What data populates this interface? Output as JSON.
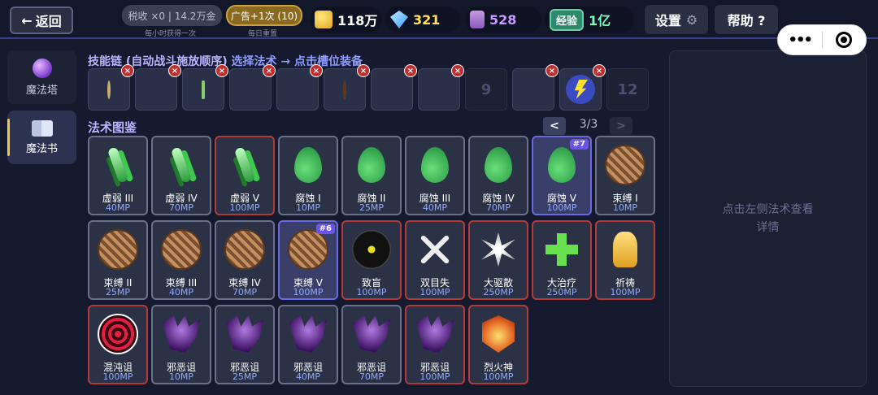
{
  "topbar": {
    "back_label": "返回",
    "tax": "税收 ×0 | 14.2万金",
    "tax_sub": "每小时获得一次",
    "ad": "广告+1次 (10)",
    "ad_sub": "每日重置",
    "gold": "118万",
    "gems": "321",
    "potions": "528",
    "exp_label": "经验",
    "exp_value": "1亿",
    "settings_label": "设置",
    "help_label": "帮助 ?"
  },
  "sidebar": {
    "items": [
      {
        "label": "魔法塔",
        "icon": "orb-icon"
      },
      {
        "label": "魔法书",
        "icon": "book-icon",
        "active": true
      }
    ]
  },
  "chain": {
    "title": "技能链 (自动战斗施放顺序)",
    "hint": "选择法术 → 点击槽位装备",
    "slots": [
      {
        "icon": "star-medal-icon"
      },
      {
        "icon": "trophy-icon"
      },
      {
        "icon": "clover-icon"
      },
      {
        "icon": "wing-icon"
      },
      {
        "icon": "lightning-dash-icon"
      },
      {
        "icon": "bind-ball-icon"
      },
      {
        "icon": "poison-drop-icon"
      },
      {
        "icon": "golden-eye-icon"
      },
      {
        "label": "9"
      },
      {
        "icon": "duel-icon"
      },
      {
        "icon": "lightning-orb-icon"
      },
      {
        "label": "12"
      }
    ]
  },
  "grimoire": {
    "title": "法术图鉴",
    "page": "3/3",
    "prev": "<",
    "next": ">",
    "spells": [
      {
        "name": "虚弱 III",
        "mp": "40MP",
        "art": "claw"
      },
      {
        "name": "虚弱 IV",
        "mp": "70MP",
        "art": "claw"
      },
      {
        "name": "虚弱 V",
        "mp": "100MP",
        "art": "claw",
        "red": true
      },
      {
        "name": "腐蚀 I",
        "mp": "10MP",
        "art": "drop"
      },
      {
        "name": "腐蚀 II",
        "mp": "25MP",
        "art": "drop"
      },
      {
        "name": "腐蚀 III",
        "mp": "40MP",
        "art": "drop"
      },
      {
        "name": "腐蚀 IV",
        "mp": "70MP",
        "art": "drop"
      },
      {
        "name": "腐蚀 V",
        "mp": "100MP",
        "art": "drop",
        "badge": "#7",
        "sel": true
      },
      {
        "name": "束缚 I",
        "mp": "10MP",
        "art": "ball"
      },
      {
        "name": "束缚 II",
        "mp": "25MP",
        "art": "ball"
      },
      {
        "name": "束缚 III",
        "mp": "40MP",
        "art": "ball"
      },
      {
        "name": "束缚 IV",
        "mp": "70MP",
        "art": "ball"
      },
      {
        "name": "束缚 V",
        "mp": "100MP",
        "art": "ball",
        "badge": "#6",
        "sel": true
      },
      {
        "name": "致盲",
        "mp": "100MP",
        "art": "eye",
        "red": true
      },
      {
        "name": "双目失",
        "mp": "100MP",
        "art": "cross",
        "red": true
      },
      {
        "name": "大驱散",
        "mp": "250MP",
        "art": "burst",
        "red": true
      },
      {
        "name": "大治疗",
        "mp": "250MP",
        "art": "plus",
        "red": true
      },
      {
        "name": "祈祷",
        "mp": "100MP",
        "art": "pray",
        "red": true
      },
      {
        "name": "混沌诅",
        "mp": "100MP",
        "art": "vortex",
        "red": true
      },
      {
        "name": "邪恶诅",
        "mp": "10MP",
        "art": "evil"
      },
      {
        "name": "邪恶诅",
        "mp": "25MP",
        "art": "evil"
      },
      {
        "name": "邪恶诅",
        "mp": "40MP",
        "art": "evil"
      },
      {
        "name": "邪恶诅",
        "mp": "70MP",
        "art": "evil"
      },
      {
        "name": "邪恶诅",
        "mp": "100MP",
        "art": "evil",
        "red": true
      },
      {
        "name": "烈火神",
        "mp": "100MP",
        "art": "fire",
        "red": true
      }
    ]
  },
  "detail": {
    "placeholder": "点击左侧法术查看详情"
  }
}
